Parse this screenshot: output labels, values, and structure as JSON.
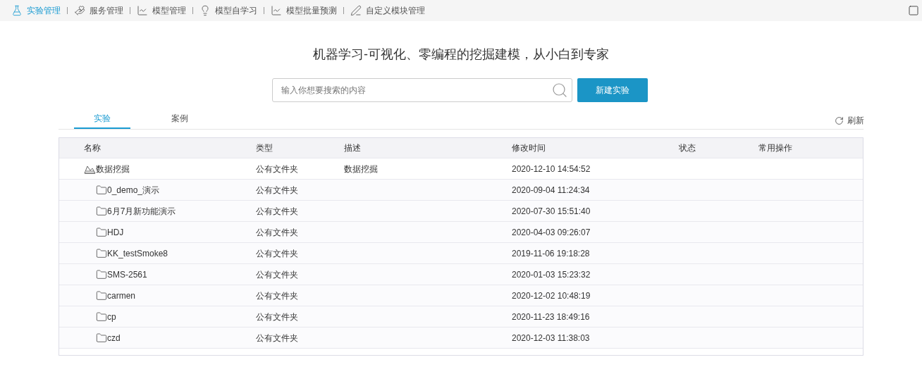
{
  "nav": [
    {
      "label": "实验管理",
      "selected": true
    },
    {
      "label": "服务管理",
      "selected": false
    },
    {
      "label": "模型管理",
      "selected": false
    },
    {
      "label": "模型自学习",
      "selected": false
    },
    {
      "label": "模型批量预测",
      "selected": false
    },
    {
      "label": "自定义模块管理",
      "selected": false
    }
  ],
  "headline": "机器学习-可视化、零编程的挖掘建模，从小白到专家",
  "search": {
    "placeholder": "输入你想要搜索的内容"
  },
  "new_button": "新建实验",
  "tabs": [
    {
      "label": "实验",
      "selected": true
    },
    {
      "label": "案例",
      "selected": false
    }
  ],
  "refresh": "刷新",
  "table": {
    "columns": [
      "名称",
      "类型",
      "描述",
      "修改时间",
      "状态",
      "常用操作"
    ],
    "rows": [
      {
        "name": "数据挖掘",
        "type": "公有文件夹",
        "description": "数据挖掘",
        "modified": "2020-12-10 14:54:52",
        "expanded": true,
        "children": [
          {
            "name": "0_demo_演示",
            "type": "公有文件夹",
            "modified": "2020-09-04 11:24:34"
          },
          {
            "name": "6月7月新功能演示",
            "type": "公有文件夹",
            "modified": "2020-07-30 15:51:40"
          },
          {
            "name": "HDJ",
            "type": "公有文件夹",
            "modified": "2020-04-03 09:26:07"
          },
          {
            "name": "KK_testSmoke8",
            "type": "公有文件夹",
            "modified": "2019-11-06 19:18:28"
          },
          {
            "name": "SMS-2561",
            "type": "公有文件夹",
            "modified": "2020-01-03 15:23:32"
          },
          {
            "name": "carmen",
            "type": "公有文件夹",
            "modified": "2020-12-02 10:48:19"
          },
          {
            "name": "cp",
            "type": "公有文件夹",
            "modified": "2020-11-23 18:49:16"
          },
          {
            "name": "czd",
            "type": "公有文件夹",
            "modified": "2020-12-03 11:38:03"
          }
        ]
      }
    ]
  }
}
